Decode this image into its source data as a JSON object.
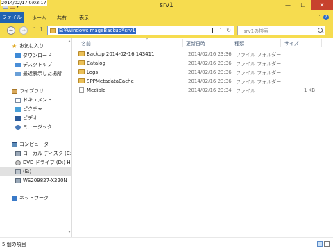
{
  "timestamp": "2014/02/17 0:03:17",
  "window": {
    "title": "srv1",
    "minimize": "—",
    "maximize": "☐",
    "close": "✕"
  },
  "ribbon": {
    "tabs": [
      "ファイル",
      "ホーム",
      "共有",
      "表示"
    ],
    "expand": "˅",
    "help": "?"
  },
  "nav": {
    "back": "←",
    "forward": "→",
    "recent": "˅",
    "up": "↑",
    "address": "E:¥WindowsImageBackup¥srv1",
    "address_dropdown": "˅",
    "refresh": "↻",
    "search_placeholder": "srv1の検索"
  },
  "sidebar": {
    "favorites": {
      "label": "お気に入り",
      "items": [
        "ダウンロード",
        "デスクトップ",
        "最近表示した場所"
      ]
    },
    "libraries": {
      "label": "ライブラリ",
      "items": [
        "ドキュメント",
        "ピクチャ",
        "ビデオ",
        "ミュージック"
      ]
    },
    "computer": {
      "label": "コンピューター",
      "items": [
        "ローカル ディスク (C:)",
        "DVD ドライブ (D:) H",
        "(E:)",
        "WS209827-X220N"
      ]
    },
    "network": {
      "label": "ネットワーク"
    }
  },
  "columns": {
    "name": "名前",
    "date": "更新日時",
    "type": "種類",
    "size": "サイズ",
    "sort_indicator": "^"
  },
  "files": [
    {
      "name": "Backup 2014-02-16 143411",
      "date": "2014/02/16 23:36",
      "type": "ファイル フォルダー",
      "size": "",
      "kind": "folder"
    },
    {
      "name": "Catalog",
      "date": "2014/02/16 23:36",
      "type": "ファイル フォルダー",
      "size": "",
      "kind": "folder"
    },
    {
      "name": "Logs",
      "date": "2014/02/16 23:36",
      "type": "ファイル フォルダー",
      "size": "",
      "kind": "folder"
    },
    {
      "name": "SPPMetadataCache",
      "date": "2014/02/16 23:36",
      "type": "ファイル フォルダー",
      "size": "",
      "kind": "folder"
    },
    {
      "name": "MediaId",
      "date": "2014/02/16 23:34",
      "type": "ファイル",
      "size": "1 KB",
      "kind": "file"
    }
  ],
  "status": {
    "item_count": "5 個の項目"
  },
  "colors": {
    "accent": "#f6dc4f",
    "file_tab": "#1f63b2",
    "close": "#c7422e",
    "selection": "#3168c3"
  }
}
